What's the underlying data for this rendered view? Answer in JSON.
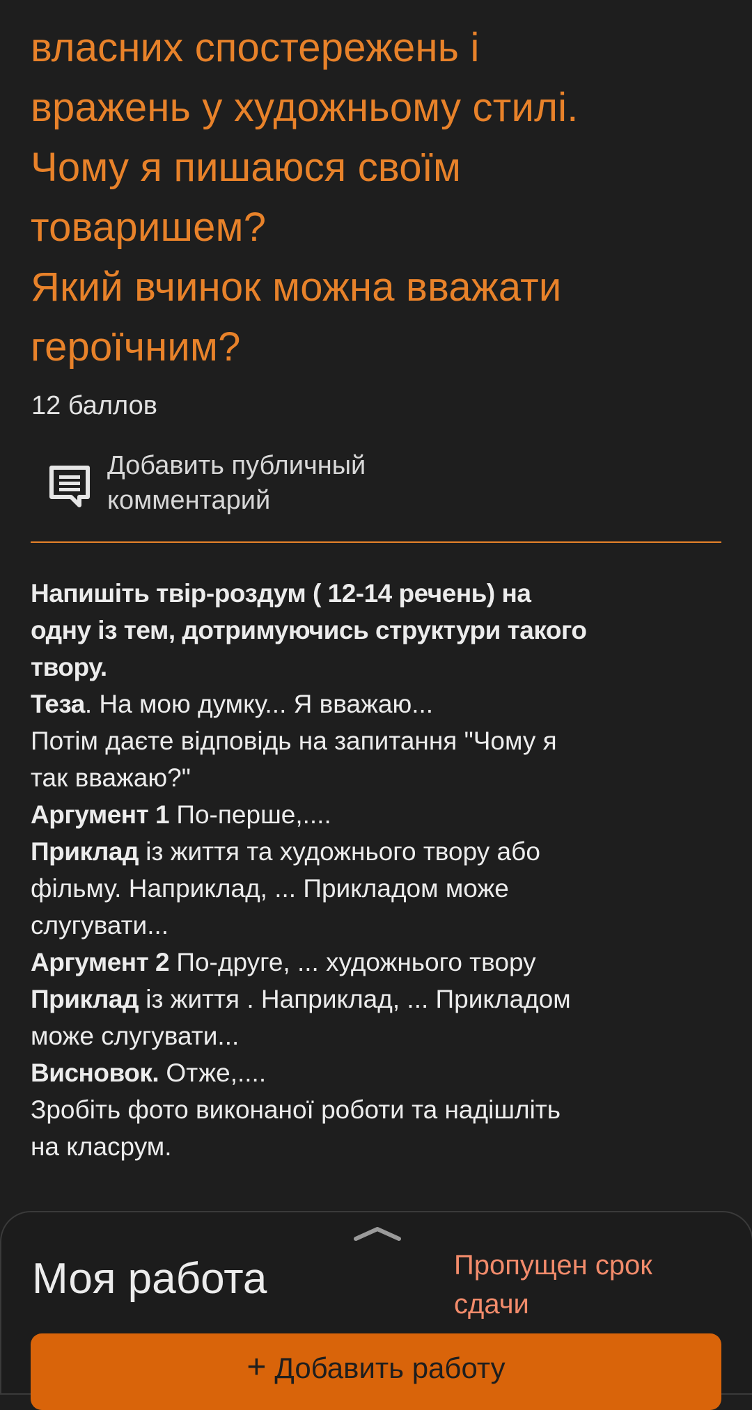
{
  "assignment": {
    "title_lines": [
      "власних спостережень і",
      "вражень у художньому стилі.",
      "Чому я пишаюся своїм",
      "товаришем?",
      "Який вчинок можна вважати",
      "героїчним?"
    ],
    "points": "12 баллов"
  },
  "comment": {
    "label": "Добавить публичный комментарий",
    "icon": "comment-icon"
  },
  "instructions": {
    "intro_bold": [
      "Напишіть твір-роздум ( 12-14 речень) на",
      "одну із тем, дотримуючись структури такого",
      "твору."
    ],
    "thesis_label": "Теза",
    "thesis_text": ". На мою думку... Я вважаю...",
    "thesis_note": [
      "Потім даєте відповідь на запитання \"Чому я",
      "так вважаю?\""
    ],
    "arg1_label": "Аргумент 1",
    "arg1_text": " По-перше,....",
    "ex1_label": "Приклад",
    "ex1_text_lines": [
      " із життя та художнього твору або",
      "фільму. Наприклад, ... Прикладом може",
      "слугувати..."
    ],
    "arg2_label": "Аргумент 2",
    "arg2_text": " По-друге,  ... художнього твору",
    "ex2_label": "Приклад",
    "ex2_text_lines": [
      " із  життя . Наприклад, ... Прикладом",
      "може слугувати..."
    ],
    "conclusion_label": "Висновок.",
    "conclusion_text": "  Отже,....",
    "footer_lines": [
      "Зробіть фото виконаної роботи та надішліть",
      "на класрум."
    ]
  },
  "my_work": {
    "title": "Моя работа",
    "status": "Пропущен срок сдачи",
    "add_button_label": "Добавить работу",
    "add_button_icon": "plus-icon"
  },
  "colors": {
    "background": "#1e1e1e",
    "accent": "#e8822a",
    "status": "#f28b6b",
    "button": "#d9640a"
  }
}
